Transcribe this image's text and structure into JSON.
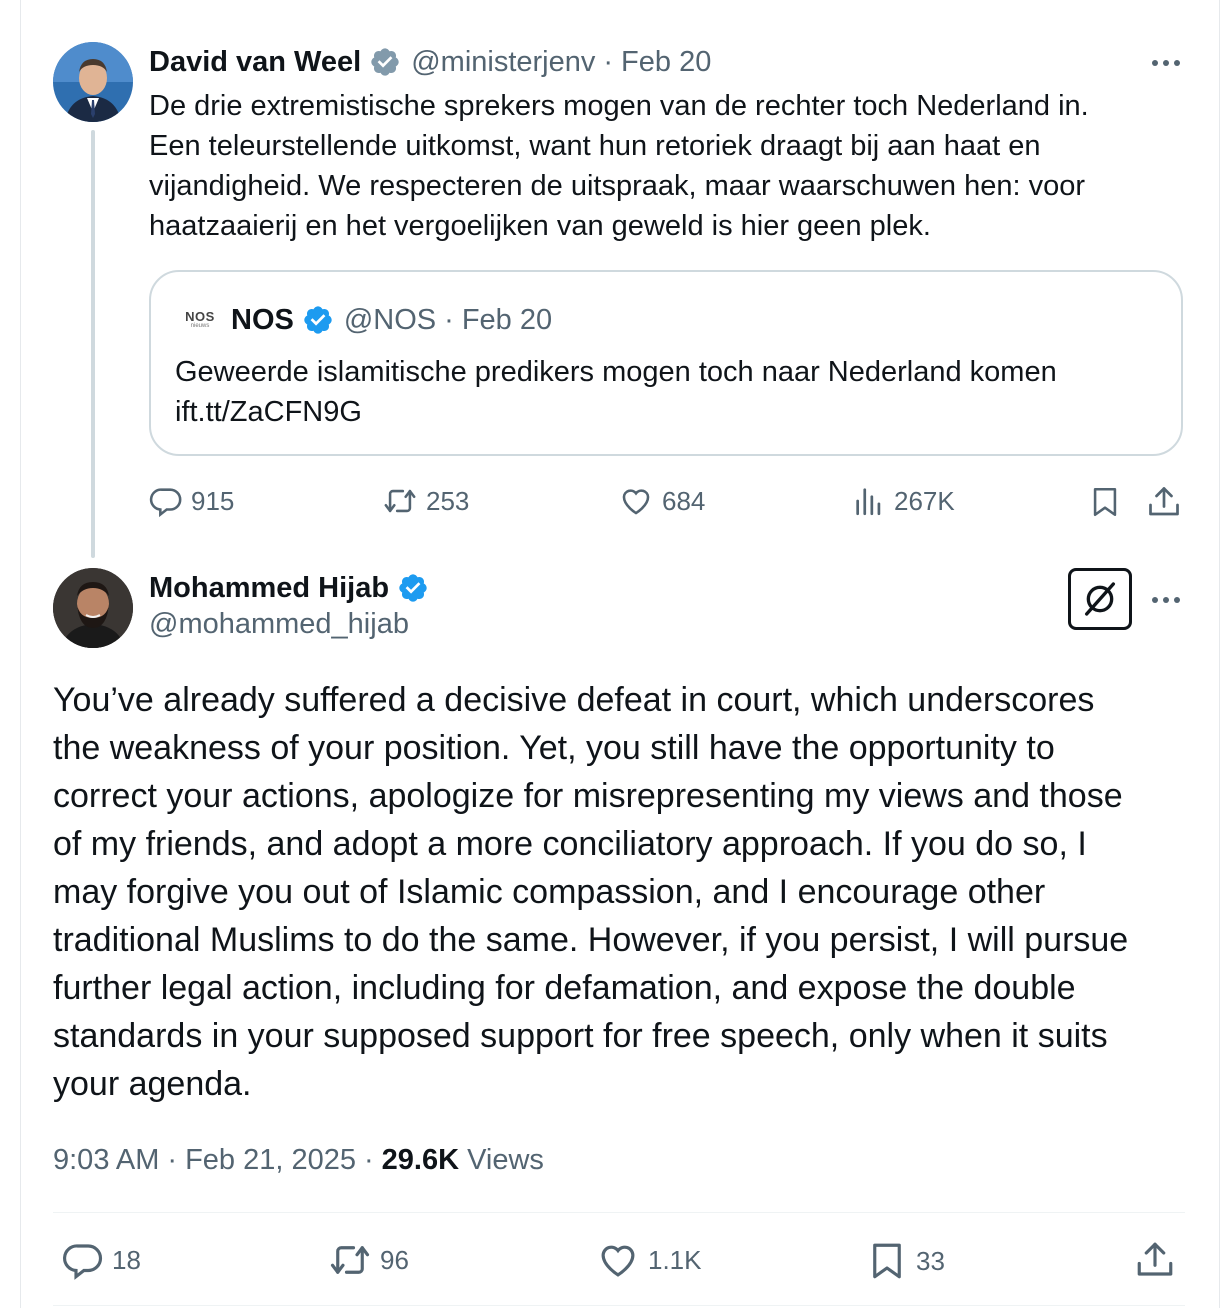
{
  "parent_tweet": {
    "author_name": "David van Weel",
    "handle": "@ministerjenv",
    "sep": "·",
    "date": "Feb 20",
    "text_lines": [
      "De drie extremistische sprekers mogen van de rechter toch Nederland in.",
      "Een teleurstellende uitkomst, want hun retoriek draagt bij aan haat en",
      "vijandigheid. We respecteren de uitspraak, maar waarschuwen hen: voor",
      "haatzaaierij en het vergoelijken van geweld is hier geen plek."
    ],
    "quote": {
      "logo_line1": "NOS",
      "logo_line2": "nieuws",
      "author_name": "NOS",
      "handle": "@NOS",
      "sep": "·",
      "date": "Feb 20",
      "text_line1": "Geweerde islamitische predikers mogen toch naar Nederland komen",
      "text_line2": "ift.tt/ZaCFN9G"
    },
    "replies": "915",
    "reposts": "253",
    "likes": "684",
    "views": "267K"
  },
  "main_tweet": {
    "author_name": "Mohammed Hijab",
    "handle": "@mohammed_hijab",
    "text_lines": [
      "You’ve already suffered a decisive defeat in court, which underscores",
      "the weakness of your position. Yet, you still have the opportunity to",
      "correct your actions, apologize for misrepresenting my views and those",
      "of my friends, and adopt a more conciliatory approach. If you do so, I",
      "may forgive you out of Islamic compassion, and I encourage other",
      "traditional Muslims to do the same. However, if you persist, I will pursue",
      "further legal action, including for defamation, and expose the double",
      "standards in your supposed support for free speech, only when it suits",
      "your agenda."
    ],
    "time": "9:03 AM",
    "sep1": "·",
    "date": "Feb 21, 2025",
    "sep2": "·",
    "views_count": "29.6K",
    "views_label": "Views",
    "replies": "18",
    "reposts": "96",
    "likes": "1.1K",
    "bookmarks": "33"
  },
  "icons": [
    "verified-badge-icon",
    "grok-icon",
    "more-icon",
    "reply-icon",
    "repost-icon",
    "like-icon",
    "views-icon",
    "bookmark-icon",
    "share-icon"
  ],
  "colors": {
    "verified_blue": "#1d9bf0",
    "verified_grey": "#829aab",
    "text": "#0f1419",
    "muted": "#536471",
    "border": "#cfd9de"
  }
}
